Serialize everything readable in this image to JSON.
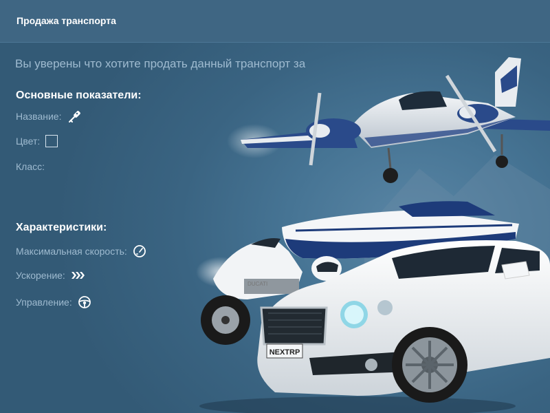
{
  "window": {
    "title": "Продажа транспорта"
  },
  "prompt": "Вы уверены что хотите продать данный транспорт за",
  "main_specs": {
    "heading": "Основные показатели:",
    "name_label": "Название:",
    "name_icon": "key-icon",
    "color_label": "Цвет:",
    "color_value": "transparent",
    "class_label": "Класс:"
  },
  "characteristics": {
    "heading": "Характеристики:",
    "max_speed_label": "Максимальная скорость:",
    "max_speed_icon": "speedometer-icon",
    "acceleration_label": "Ускорение:",
    "acceleration_icon": "chevrons-right-icon",
    "handling_label": "Управление:",
    "handling_icon": "steering-wheel-icon"
  },
  "illustration": {
    "plate_text": "NEXTRP",
    "bike_brand": "DUCATI"
  },
  "colors": {
    "accent_text": "#9fbbd0",
    "heading_text": "#ffffff",
    "background": "#3d6683"
  }
}
